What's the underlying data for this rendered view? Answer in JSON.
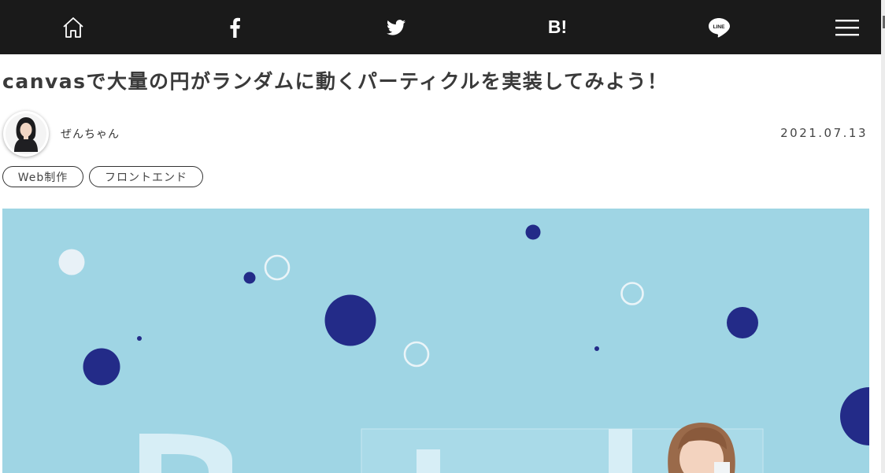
{
  "nav": {
    "items": [
      {
        "name": "home",
        "icon": "home-icon"
      },
      {
        "name": "facebook",
        "icon": "facebook-icon"
      },
      {
        "name": "twitter",
        "icon": "twitter-icon"
      },
      {
        "name": "hatena-bookmark",
        "icon": "hatena-bookmark-icon",
        "label": "B!"
      },
      {
        "name": "line",
        "icon": "line-icon",
        "label": "LINE"
      },
      {
        "name": "menu",
        "icon": "hamburger-menu-icon"
      }
    ]
  },
  "article": {
    "title": "canvasで大量の円がランダムに動くパーティクルを実装してみよう！",
    "author": "ぜんちゃん",
    "date": "2021.07.13",
    "tags": [
      "Web制作",
      "フロントエンド"
    ]
  },
  "colors": {
    "header_bg": "#1a1a1a",
    "hero_bg": "#9fd5e4",
    "circle_dark": "#232b88",
    "circle_light": "#e8f1f7"
  }
}
